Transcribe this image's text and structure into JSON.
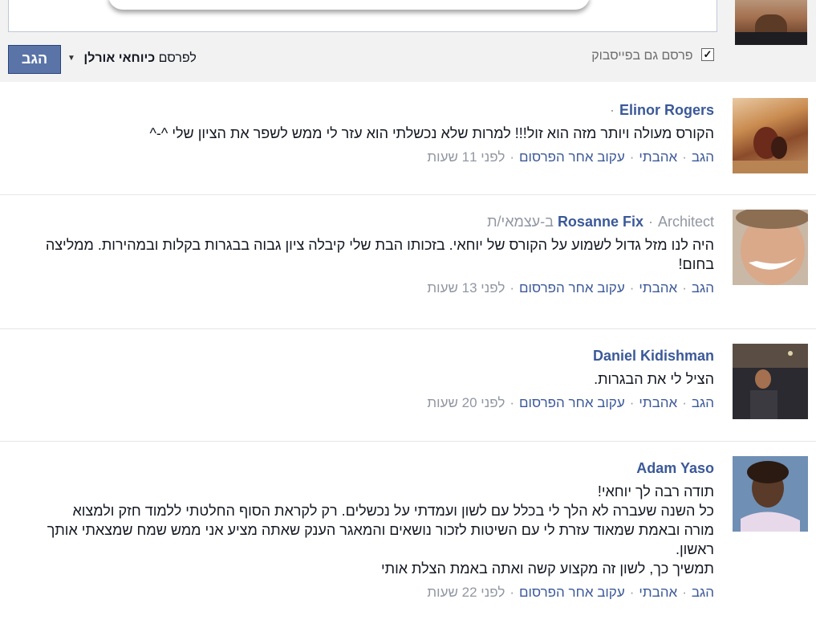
{
  "composer": {
    "post_button": "הגב",
    "post_as_prefix": "לפרסם",
    "post_as_name": "כיוחאי אורלן",
    "facebook_checkbox_label": "פרסם גם בפייסבוק"
  },
  "actions": {
    "reply": "הגב",
    "like": "אהבתי",
    "follow": "עקוב אחר הפרסום"
  },
  "comments": [
    {
      "author": "Elinor Rogers",
      "meta": "",
      "text": "הקורס מעולה ויותר מזה הוא זול!!! למרות שלא נכשלתי הוא עזר לי ממש לשפר את הציון שלי ^-^",
      "time": "לפני 11 שעות"
    },
    {
      "author": "Rosanne Fix",
      "meta": "Architect ב-עצמאי/ת",
      "text": "היה לנו מזל גדול לשמוע על הקורס של יוחאי. בזכותו הבת שלי קיבלה ציון גבוה בבגרות בקלות ובמהירות. ממליצה בחום!",
      "time": "לפני 13 שעות"
    },
    {
      "author": "Daniel Kidishman",
      "meta": "",
      "text": "הציל לי את הבגרות.",
      "time": "לפני 20 שעות"
    },
    {
      "author": "Adam Yaso",
      "meta": "",
      "text": "תודה רבה לך יוחאי!\nכל השנה שעברה לא הלך לי בכלל עם לשון ועמדתי על נכשלים. רק לקראת הסוף החלטתי ללמוד חזק ולמצוא מורה ובאמת שמאוד עזרת לי עם השיטות לזכור נושאים והמאגר הענק שאתה מציע אני ממש שמח שמצאתי אותך ראשון.\nתמשיך כך, לשון זה מקצוע קשה ואתה באמת הצלת אותי",
      "time": "לפני 22 שעות"
    }
  ]
}
